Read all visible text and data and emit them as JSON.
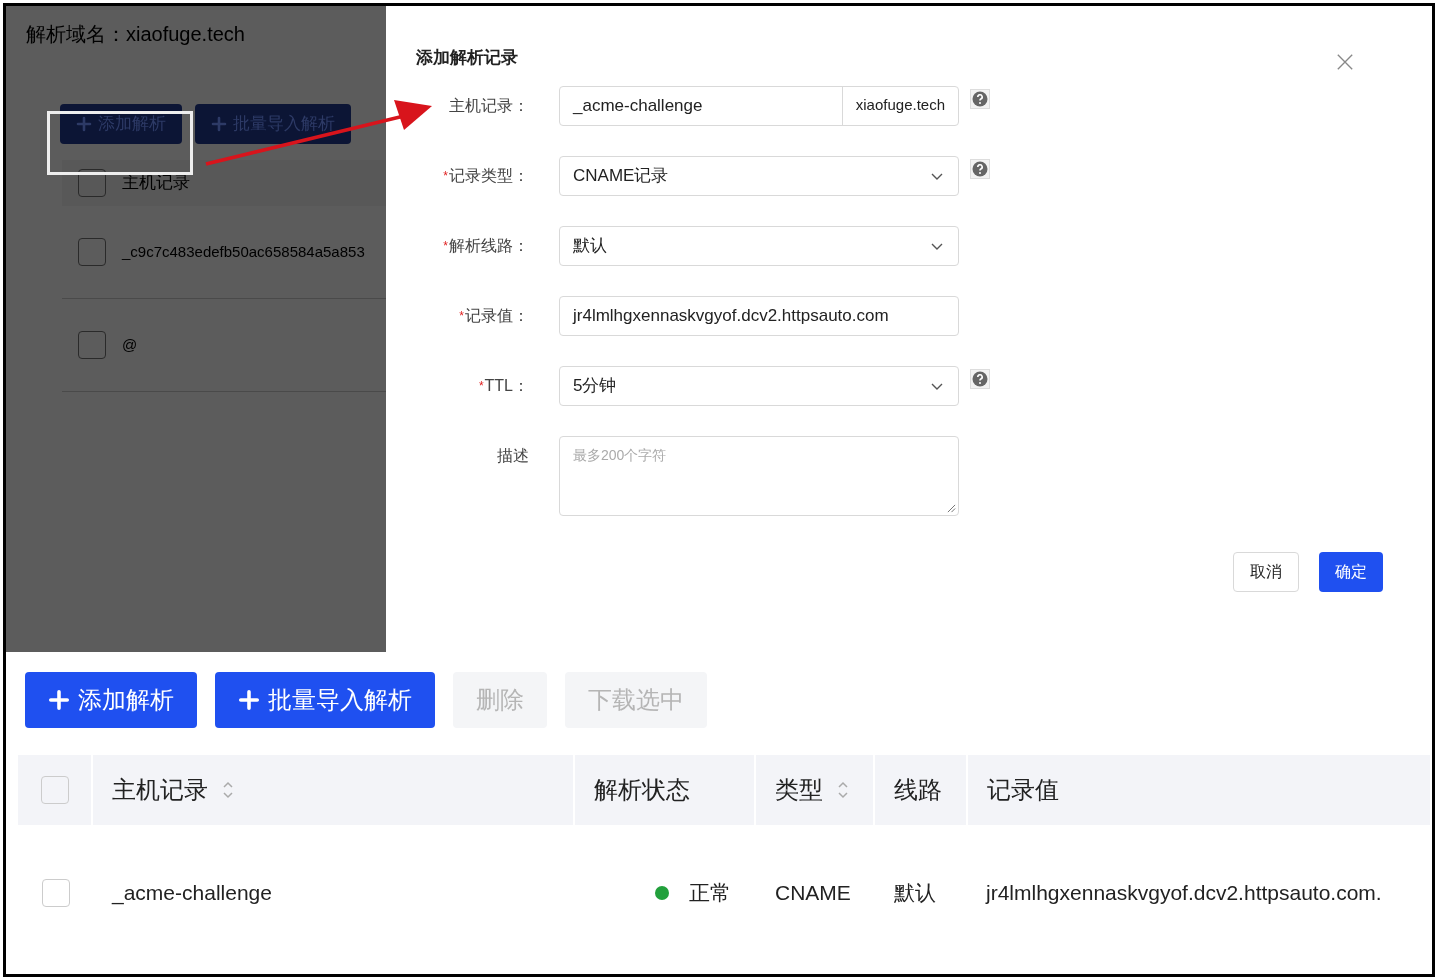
{
  "background_page": {
    "domain_label": "解析域名：xiaofuge.tech",
    "buttons": [
      {
        "label": "添加解析"
      },
      {
        "label": "批量导入解析"
      }
    ],
    "table": {
      "header_checked": false,
      "column": "主机记录",
      "rows": [
        {
          "host": "_c9c7c483edefb50ac658584a5a853",
          "checked": false
        },
        {
          "host": "@",
          "checked": false
        }
      ]
    }
  },
  "dialog": {
    "title": "添加解析记录",
    "fields": [
      {
        "kind": "input_addon",
        "label": "主机记录：",
        "value": "_acme-challenge",
        "addon": "xiaofuge.tech",
        "help": true
      },
      {
        "kind": "select",
        "required_mark": "*",
        "label": "记录类型：",
        "value": "CNAME记录",
        "help": true
      },
      {
        "kind": "select",
        "required_mark": "*",
        "label": "解析线路：",
        "value": "默认",
        "help": false
      },
      {
        "kind": "input",
        "required_mark": "*",
        "label": "记录值：",
        "value": "jr4lmlhgxennaskvgyof.dcv2.httpsauto.com",
        "help": false
      },
      {
        "kind": "select",
        "required_mark": "*",
        "label": "TTL：",
        "value": "5分钟",
        "help": true
      },
      {
        "kind": "textarea",
        "label": "描述",
        "placeholder": "最多200个字符",
        "help": false
      }
    ],
    "buttons": [
      {
        "label": "取消",
        "kind": "default"
      },
      {
        "label": "确定",
        "kind": "primary"
      }
    ]
  },
  "toolbar": [
    {
      "label": "添加解析",
      "disabled": false
    },
    {
      "label": "批量导入解析",
      "disabled": false
    },
    {
      "label": "删除",
      "disabled": true
    },
    {
      "label": "下载选中",
      "disabled": true
    }
  ],
  "table": {
    "header_checked": false,
    "columns": [
      {
        "label": "主机记录",
        "sortable": true
      },
      {
        "label": "解析状态",
        "sortable": false
      },
      {
        "label": "类型",
        "sortable": true
      },
      {
        "label": "线路",
        "sortable": false
      },
      {
        "label": "记录值",
        "sortable": false
      }
    ],
    "rows": [
      {
        "checked": false,
        "host": "_acme-challenge",
        "status": "正常",
        "color": "#22a03c",
        "type": "CNAME",
        "line": "默认",
        "value": "jr4lmlhgxennaskvgyof.dcv2.httpsauto.com."
      }
    ]
  }
}
